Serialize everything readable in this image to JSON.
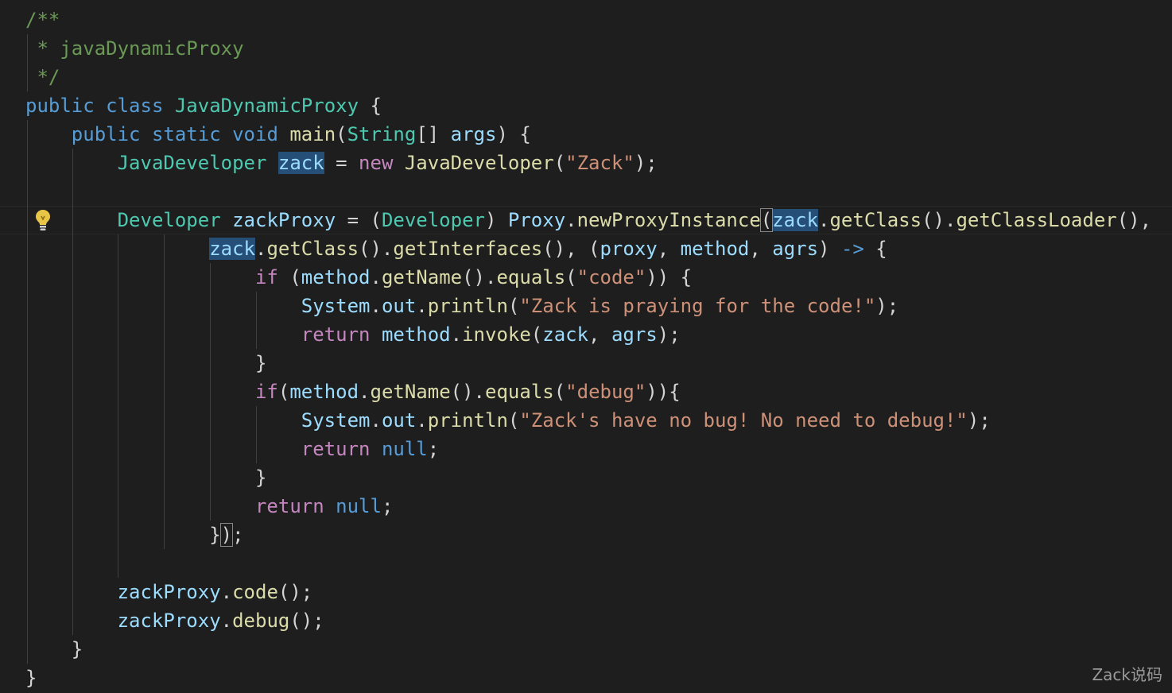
{
  "editor": {
    "theme": "dark",
    "colors": {
      "background": "#1e1e1e",
      "comment": "#6a9955",
      "keyword": "#569cd6",
      "control": "#c586c0",
      "type": "#4ec9b0",
      "function": "#dcdcaa",
      "variable": "#9cdcfe",
      "string": "#ce9178",
      "selection_highlight": "#264f78"
    },
    "gutter_icon": "lightbulb-icon",
    "tokens": {
      "doc_open": "/**",
      "doc_body": " * javaDynamicProxy",
      "doc_close": " */",
      "kw_public": "public",
      "kw_class": "class",
      "kw_static": "static",
      "kw_void": "void",
      "kw_new": "new",
      "kw_if": "if",
      "kw_return": "return",
      "kw_null": "null",
      "cls_JavaDynamicProxy": "JavaDynamicProxy",
      "fn_main": "main",
      "type_String": "String",
      "var_args": "args",
      "type_JavaDeveloper": "JavaDeveloper",
      "var_zack": "zack",
      "fn_JavaDeveloper": "JavaDeveloper",
      "str_zack": "\"Zack\"",
      "type_Developer": "Developer",
      "var_zackProxy": "zackProxy",
      "var_Proxy": "Proxy",
      "fn_newProxyInstance": "newProxyInstance",
      "fn_getClass": "getClass",
      "fn_getClassLoader": "getClassLoader",
      "fn_getInterfaces": "getInterfaces",
      "p_proxy": "proxy",
      "p_method": "method",
      "p_agrs": "agrs",
      "arrow": "->",
      "var_method": "method",
      "fn_getName": "getName",
      "fn_equals": "equals",
      "str_code": "\"code\"",
      "var_System": "System",
      "var_out": "out",
      "fn_println": "println",
      "str_praying": "\"Zack is praying for the code!\"",
      "fn_invoke": "invoke",
      "str_debug": "\"debug\"",
      "str_nobug": "\"Zack's have no bug! No need to debug!\"",
      "fn_code": "code",
      "fn_debug": "debug"
    }
  },
  "watermark": "Zack说码"
}
